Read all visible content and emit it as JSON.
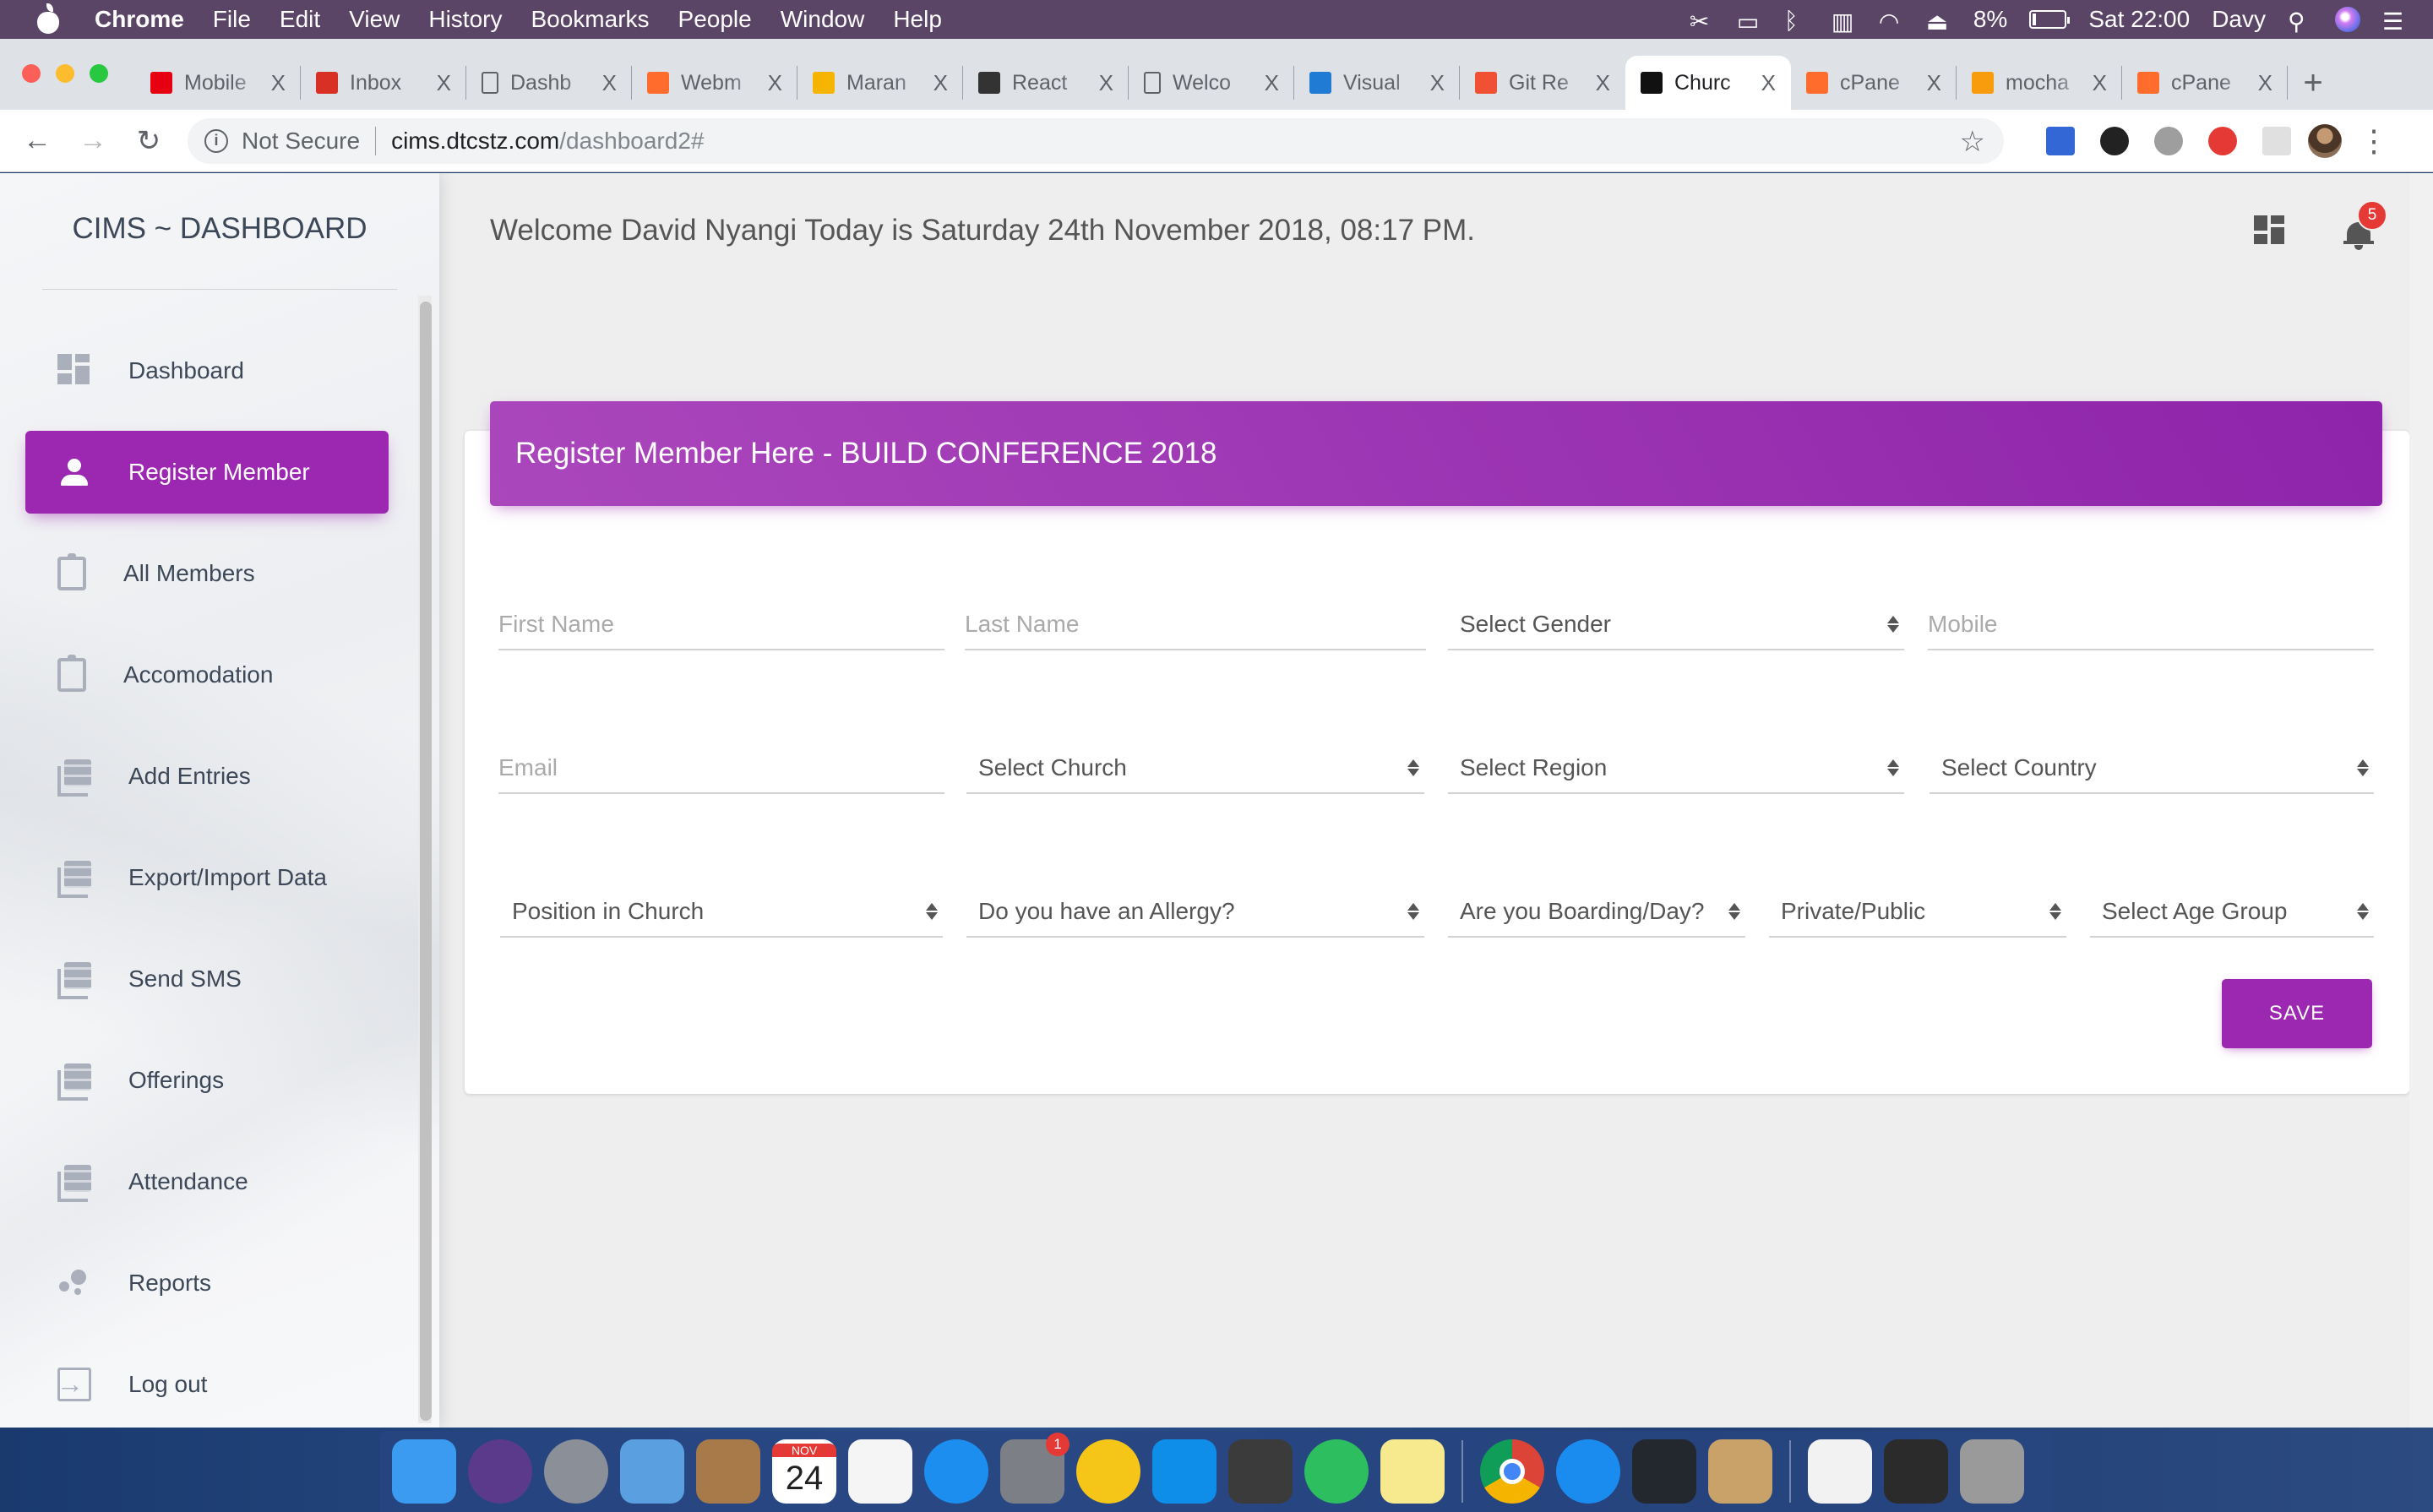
{
  "menubar": {
    "app_name": "Chrome",
    "menus": [
      "File",
      "Edit",
      "View",
      "History",
      "Bookmarks",
      "People",
      "Window",
      "Help"
    ],
    "battery": "8%",
    "clock": "Sat 22:00",
    "user": "Davy",
    "status_icons": [
      "scissors-icon",
      "airplay-icon",
      "bluetooth-icon",
      "keyboard-icon",
      "wifi-icon",
      "eject-icon",
      "battery-icon",
      "search-icon",
      "siri-icon",
      "list-icon"
    ]
  },
  "browser": {
    "tabs": [
      {
        "title": "Mobile",
        "icon": "huawei-icon",
        "color": "#e60012",
        "active": false
      },
      {
        "title": "Inbox",
        "icon": "gmail-icon",
        "color": "#d93025",
        "active": false
      },
      {
        "title": "Dashb",
        "icon": "document-icon",
        "color": "#5f6368",
        "active": false
      },
      {
        "title": "Webm",
        "icon": "cpanel-icon",
        "color": "#ff6c2c",
        "active": false
      },
      {
        "title": "Maran",
        "icon": "graduation-cap-icon",
        "color": "#f4b400",
        "active": false
      },
      {
        "title": "React",
        "icon": "mustache-icon",
        "color": "#333333",
        "active": false
      },
      {
        "title": "Welco",
        "icon": "document-icon",
        "color": "#5f6368",
        "active": false
      },
      {
        "title": "Visual",
        "icon": "vscode-icon",
        "color": "#1f7bd4",
        "active": false
      },
      {
        "title": "Git Re",
        "icon": "git-icon",
        "color": "#f05033",
        "active": false
      },
      {
        "title": "Churc",
        "icon": "bowtie-icon",
        "color": "#111111",
        "active": true
      },
      {
        "title": "cPane",
        "icon": "cpanel-icon",
        "color": "#ff6c2c",
        "active": false
      },
      {
        "title": "mocha",
        "icon": "phpmyadmin-icon",
        "color": "#f89c0e",
        "active": false
      },
      {
        "title": "cPane",
        "icon": "cpanel-icon",
        "color": "#ff6c2c",
        "active": false
      }
    ],
    "close_glyph": "X",
    "new_tab_glyph": "+",
    "security_label": "Not Secure",
    "url_host": "cims.dtcstz.com",
    "url_path": "/dashboard2#",
    "extensions": [
      {
        "name": "lighthouse-ext-icon",
        "color": "#3367d6"
      },
      {
        "name": "helmet-ext-icon",
        "color": "#222222"
      },
      {
        "name": "cloud-ext-icon",
        "color": "#9e9e9e"
      },
      {
        "name": "adblock-ext-icon",
        "color": "#e53935"
      },
      {
        "name": "react-ext-icon",
        "color": "#e0e0e0"
      }
    ]
  },
  "app": {
    "brand": "CIMS ~ DASHBOARD",
    "accent_color": "#9c27b0",
    "sidebar": {
      "items": [
        {
          "label": "Dashboard",
          "icon": "dashboard-icon",
          "active": false
        },
        {
          "label": "Register Member",
          "icon": "person-icon",
          "active": true
        },
        {
          "label": "All Members",
          "icon": "clipboard-icon",
          "active": false
        },
        {
          "label": "Accomodation",
          "icon": "clipboard-icon",
          "active": false
        },
        {
          "label": "Add Entries",
          "icon": "library-books-icon",
          "active": false
        },
        {
          "label": "Export/Import Data",
          "icon": "library-books-icon",
          "active": false
        },
        {
          "label": "Send SMS",
          "icon": "library-books-icon",
          "active": false
        },
        {
          "label": "Offerings",
          "icon": "library-books-icon",
          "active": false
        },
        {
          "label": "Attendance",
          "icon": "library-books-icon",
          "active": false
        },
        {
          "label": "Reports",
          "icon": "bubble-chart-icon",
          "active": false
        },
        {
          "label": "Log out",
          "icon": "logout-icon",
          "active": false
        }
      ]
    },
    "header": {
      "welcome": "Welcome David Nyangi Today is Saturday 24th November 2018, 08:17 PM.",
      "notification_count": "5"
    },
    "form": {
      "title": "Register Member Here - BUILD CONFERENCE 2018",
      "first_name": {
        "placeholder": "First Name",
        "value": ""
      },
      "last_name": {
        "placeholder": "Last Name",
        "value": ""
      },
      "gender": {
        "selected": "Select Gender"
      },
      "mobile": {
        "placeholder": "Mobile",
        "value": ""
      },
      "email": {
        "placeholder": "Email",
        "value": ""
      },
      "church": {
        "selected": "Select Church"
      },
      "region": {
        "selected": "Select Region"
      },
      "country": {
        "selected": "Select Country"
      },
      "position": {
        "selected": "Position in Church"
      },
      "allergy": {
        "selected": "Do you have an Allergy?"
      },
      "boarding": {
        "selected": "Are you Boarding/Day?"
      },
      "private_public": {
        "selected": "Private/Public"
      },
      "age_group": {
        "selected": "Select Age Group"
      },
      "save_label": "SAVE"
    }
  },
  "dock": {
    "apps": [
      {
        "name": "finder-icon",
        "color": "#3a9bf0"
      },
      {
        "name": "siri-icon",
        "color": "#5b3a8c"
      },
      {
        "name": "launchpad-icon",
        "color": "#8a8f98"
      },
      {
        "name": "mail-icon",
        "color": "#5aa0e0"
      },
      {
        "name": "contacts-icon",
        "color": "#a87a4a"
      },
      {
        "name": "calendar-icon",
        "color": "#ffffff",
        "month": "NOV",
        "day": "24"
      },
      {
        "name": "reminders-icon",
        "color": "#f5f5f5"
      },
      {
        "name": "app-store-icon",
        "color": "#1c8ef0"
      },
      {
        "name": "system-preferences-icon",
        "color": "#7c7f86",
        "badge": "1"
      },
      {
        "name": "lynda-icon",
        "color": "#f5c518"
      },
      {
        "name": "teamviewer-icon",
        "color": "#0e8ee9"
      },
      {
        "name": "sublime-text-icon",
        "color": "#3b3b3b"
      },
      {
        "name": "evernote-icon",
        "color": "#2dbe60"
      },
      {
        "name": "stickies-icon",
        "color": "#f7e98e"
      },
      {
        "name": "chrome-icon",
        "color": "#4285f4"
      },
      {
        "name": "safari-icon",
        "color": "#1a8cf0"
      },
      {
        "name": "vscode-icon",
        "color": "#23272e"
      },
      {
        "name": "preview-icon",
        "color": "#c9a26a"
      },
      {
        "name": "window-thumbnail-1-icon",
        "color": "#f2f2f2"
      },
      {
        "name": "window-thumbnail-2-icon",
        "color": "#2b2b2b"
      },
      {
        "name": "trash-icon",
        "color": "#9a9a9a"
      }
    ]
  }
}
